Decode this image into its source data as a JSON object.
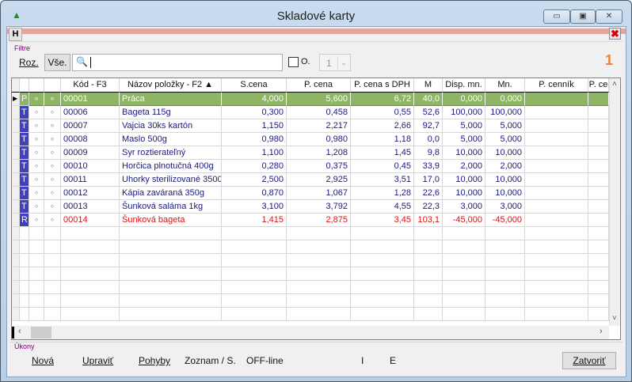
{
  "window": {
    "title": "Skladové karty",
    "minimize": "▭",
    "maximize": "▣",
    "close": "✕"
  },
  "toolbar": {
    "h_label": "H",
    "close_icon": "red-x-icon"
  },
  "filter": {
    "label": "Filtre",
    "roz": "Roz.",
    "vse": "Vše.",
    "search_value": "",
    "o_label": "O.",
    "o_checked": false,
    "combo_value": "1",
    "counter": "1"
  },
  "columns": [
    "",
    "",
    "",
    "Kód - F3",
    "Názov položky - F2 ▲",
    "S.cena",
    "P. cena",
    "P. cena s DPH",
    "M",
    "Disp. mn.",
    "Mn.",
    "P. cenník",
    "P. ce"
  ],
  "rows": [
    {
      "type": "P",
      "code": "00001",
      "name": "Práca",
      "scena": "4,000",
      "pcena": "5,600",
      "pdph": "6,72",
      "m": "40,0",
      "disp": "0,000",
      "mn": "0,000",
      "style": "selected"
    },
    {
      "type": "T",
      "code": "00006",
      "name": "Bageta 115g",
      "scena": "0,300",
      "pcena": "0,458",
      "pdph": "0,55",
      "m": "52,6",
      "disp": "100,000",
      "mn": "100,000",
      "style": "normal"
    },
    {
      "type": "T",
      "code": "00007",
      "name": "Vajcia 30ks kartón",
      "scena": "1,150",
      "pcena": "2,217",
      "pdph": "2,66",
      "m": "92,7",
      "disp": "5,000",
      "mn": "5,000",
      "style": "normal"
    },
    {
      "type": "T",
      "code": "00008",
      "name": "Maslo 500g",
      "scena": "0,980",
      "pcena": "0,980",
      "pdph": "1,18",
      "m": "0,0",
      "disp": "5,000",
      "mn": "5,000",
      "style": "normal"
    },
    {
      "type": "T",
      "code": "00009",
      "name": "Syr roztierateľný",
      "scena": "1,100",
      "pcena": "1,208",
      "pdph": "1,45",
      "m": "9,8",
      "disp": "10,000",
      "mn": "10,000",
      "style": "normal"
    },
    {
      "type": "T",
      "code": "00010",
      "name": "Horčica plnotučná 400g",
      "scena": "0,280",
      "pcena": "0,375",
      "pdph": "0,45",
      "m": "33,9",
      "disp": "2,000",
      "mn": "2,000",
      "style": "normal"
    },
    {
      "type": "T",
      "code": "00011",
      "name": "Uhorky sterilizované 3500",
      "scena": "2,500",
      "pcena": "2,925",
      "pdph": "3,51",
      "m": "17,0",
      "disp": "10,000",
      "mn": "10,000",
      "style": "normal"
    },
    {
      "type": "T",
      "code": "00012",
      "name": "Kápia zaváraná 350g",
      "scena": "0,870",
      "pcena": "1,067",
      "pdph": "1,28",
      "m": "22,6",
      "disp": "10,000",
      "mn": "10,000",
      "style": "normal"
    },
    {
      "type": "T",
      "code": "00013",
      "name": "Šunková saláma 1kg",
      "scena": "3,100",
      "pcena": "3,792",
      "pdph": "4,55",
      "m": "22,3",
      "disp": "3,000",
      "mn": "3,000",
      "style": "normal"
    },
    {
      "type": "R",
      "code": "00014",
      "name": "Šunková bageta",
      "scena": "1,415",
      "pcena": "2,875",
      "pdph": "3,45",
      "m": "103,1",
      "disp": "-45,000",
      "mn": "-45,000",
      "style": "red"
    }
  ],
  "colors": {
    "selected_bg": "#8db563",
    "normal_text": "#1a1a80",
    "red_text": "#e01010",
    "type_bg": "#4040c0",
    "accent": "#f08030"
  },
  "actions": {
    "label": "Úkony",
    "nova": "Nová",
    "upravit": "Upraviť",
    "pohyby": "Pohyby",
    "zoznam": "Zoznam / S.",
    "offline": "OFF-line",
    "i": "I",
    "e": "E",
    "zatvorit": "Zatvoriť"
  }
}
